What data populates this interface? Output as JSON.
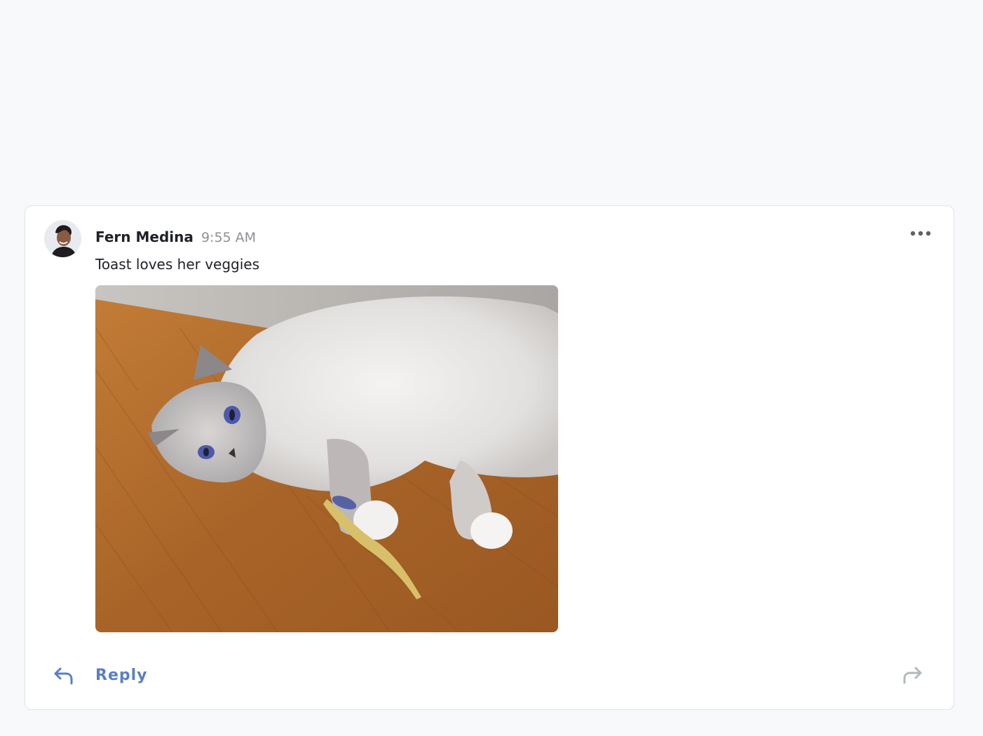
{
  "message": {
    "author": "Fern Medina",
    "time": "9:55 AM",
    "text": "Toast loves her veggies",
    "avatar_icon": "user-avatar",
    "more_icon": "more-horizontal-icon",
    "image_alt": "Fluffy white cat lying on a wooden floor next to a pea pod"
  },
  "actions": {
    "reply_label": "Reply",
    "reply_icon": "reply-arrow-icon",
    "forward_icon": "forward-arrow-icon"
  },
  "colors": {
    "background": "#f8f9fb",
    "card": "#ffffff",
    "card_border": "#dfe2e7",
    "author_text": "#1f2127",
    "time_text": "#8d9096",
    "accent": "#5b7fc2",
    "forward_icon": "#b3b8c0"
  }
}
